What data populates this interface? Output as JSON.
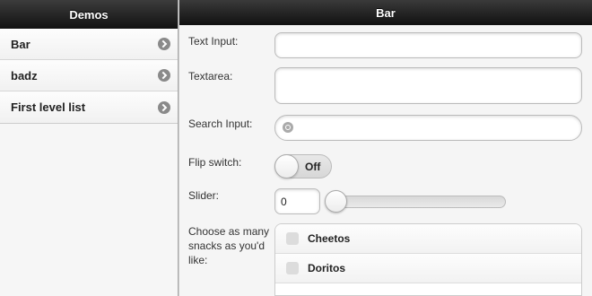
{
  "left": {
    "title": "Demos",
    "items": [
      {
        "label": "Bar"
      },
      {
        "label": "badz"
      },
      {
        "label": "First level list"
      }
    ]
  },
  "right": {
    "title": "Bar",
    "text_input": {
      "label": "Text Input:",
      "value": ""
    },
    "textarea": {
      "label": "Textarea:",
      "value": ""
    },
    "search_input": {
      "label": "Search Input:",
      "value": ""
    },
    "flip_switch": {
      "label": "Flip switch:",
      "state": "Off"
    },
    "slider": {
      "label": "Slider:",
      "value": "0"
    },
    "snacks": {
      "label": "Choose as many snacks as you'd like:",
      "options": [
        {
          "label": "Cheetos",
          "checked": false
        },
        {
          "label": "Doritos",
          "checked": false
        }
      ]
    }
  }
}
